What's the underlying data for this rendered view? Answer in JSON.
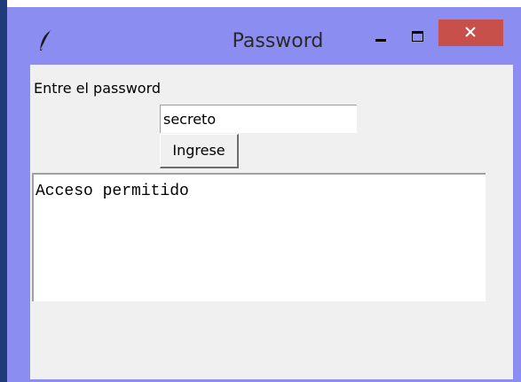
{
  "window": {
    "title": "Password",
    "app_icon": "feather-icon",
    "controls": {
      "minimize_icon": "minimize-icon",
      "maximize_icon": "maximize-icon",
      "close_icon": "close-icon"
    }
  },
  "form": {
    "prompt_label": "Entre el password",
    "password_value": "secreto",
    "submit_label": "Ingrese"
  },
  "output": {
    "text": "Acceso permitido"
  },
  "colors": {
    "frame": "#8b8ef0",
    "close_button": "#c7504a",
    "client_background": "#f0f0f0",
    "desktop": "#1e3c7a"
  }
}
